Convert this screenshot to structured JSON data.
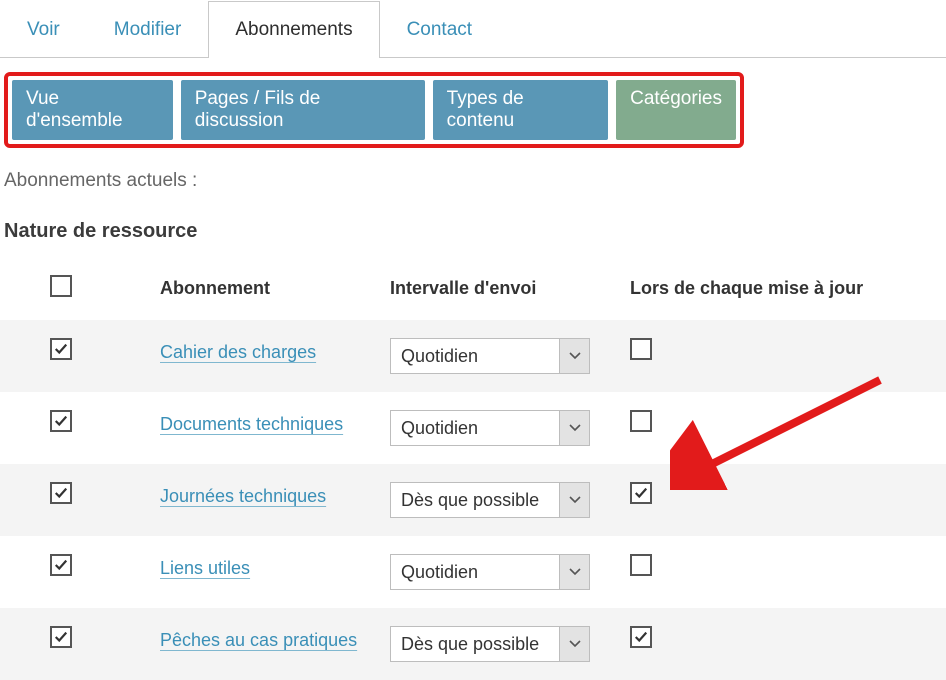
{
  "tabs": {
    "view": "Voir",
    "edit": "Modifier",
    "subscriptions": "Abonnements",
    "contact": "Contact",
    "active": "subscriptions"
  },
  "subnav": {
    "overview": "Vue d'ensemble",
    "pages": "Pages / Fils de discussion",
    "content_types": "Types de contenu",
    "categories": "Catégories"
  },
  "labels": {
    "current": "Abonnements actuels :",
    "section": "Nature de ressource",
    "col_subscription": "Abonnement",
    "col_interval": "Intervalle d'envoi",
    "col_on_update": "Lors de chaque mise à jour"
  },
  "interval_options": {
    "daily": "Quotidien",
    "asap": "Dès que possible"
  },
  "rows": [
    {
      "selected": true,
      "label": "Cahier des charges",
      "interval": "daily",
      "on_update": false
    },
    {
      "selected": true,
      "label": "Documents techniques",
      "interval": "daily",
      "on_update": false
    },
    {
      "selected": true,
      "label": "Journées techniques",
      "interval": "asap",
      "on_update": true
    },
    {
      "selected": true,
      "label": "Liens utiles",
      "interval": "daily",
      "on_update": false
    },
    {
      "selected": true,
      "label": "Pêches au cas pratiques",
      "interval": "asap",
      "on_update": true
    }
  ],
  "header_select_all": false
}
